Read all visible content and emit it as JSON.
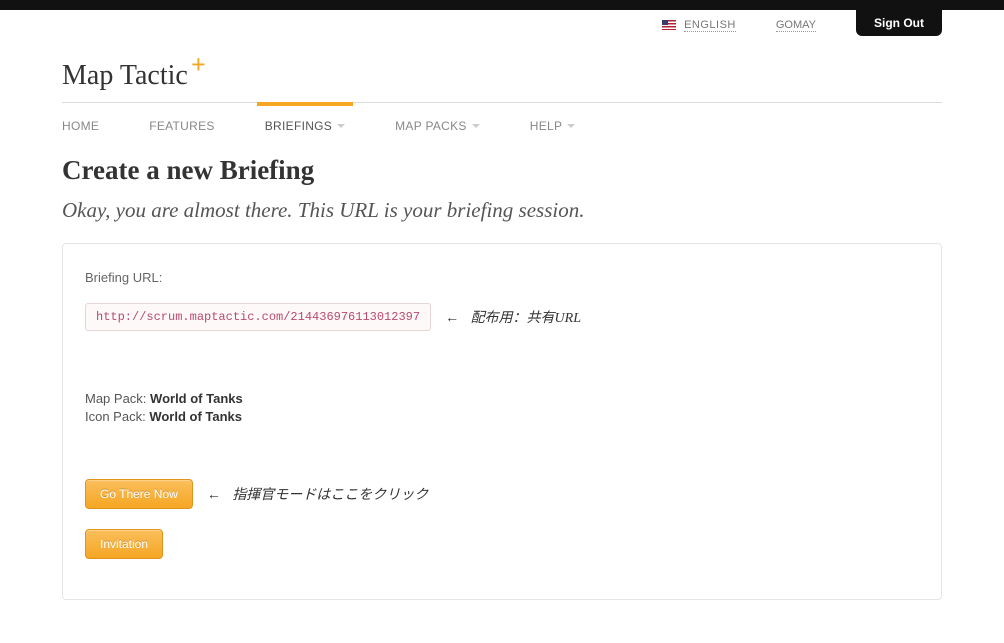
{
  "top": {
    "language": "ENGLISH",
    "username": "GOMAY",
    "signout": "Sign Out"
  },
  "brand": {
    "name": "Map Tactic",
    "plus": "+"
  },
  "nav": {
    "home": "HOME",
    "features": "FEATURES",
    "briefings": "BRIEFINGS",
    "mappacks": "MAP PACKS",
    "help": "HELP"
  },
  "page": {
    "title": "Create a new Briefing",
    "subtitle": "Okay, you are almost there. This URL is your briefing session."
  },
  "card": {
    "url_label": "Briefing URL:",
    "url_value": "http://scrum.maptactic.com/214436976113012397",
    "url_annotation": "配布用：共有URL",
    "map_pack_label": "Map Pack: ",
    "map_pack_value": "World of Tanks",
    "icon_pack_label": "Icon Pack: ",
    "icon_pack_value": "World of Tanks",
    "go_button": "Go There Now",
    "go_annotation": "指揮官モードはここをクリック",
    "invitation_button": "Invitation",
    "arrow": "←"
  }
}
